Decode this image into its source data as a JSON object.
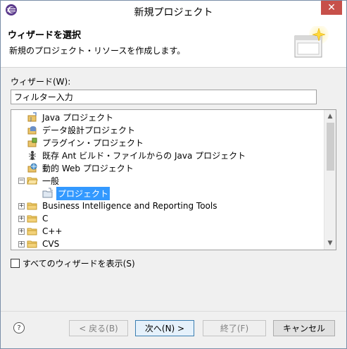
{
  "window": {
    "title": "新規プロジェクト",
    "close_label": "✕"
  },
  "header": {
    "title": "ウィザードを選択",
    "description": "新規のプロジェクト・リソースを作成します。"
  },
  "wizard_label": "ウィザード(W):",
  "filter": {
    "value": "フィルター入力"
  },
  "tree": {
    "items": [
      {
        "label": "Java プロジェクト",
        "icon": "java-project-icon"
      },
      {
        "label": "データ設計プロジェクト",
        "icon": "data-design-project-icon"
      },
      {
        "label": "プラグイン・プロジェクト",
        "icon": "plugin-project-icon"
      },
      {
        "label": "既存 Ant ビルド・ファイルからの Java プロジェクト",
        "icon": "ant-build-icon"
      },
      {
        "label": "動的 Web プロジェクト",
        "icon": "web-project-icon"
      },
      {
        "label": "一般",
        "icon": "folder-open-icon",
        "expander": "−"
      },
      {
        "label": "プロジェクト",
        "icon": "project-icon",
        "selected": true
      },
      {
        "label": "Business Intelligence and Reporting Tools",
        "icon": "folder-icon",
        "expander": "+"
      },
      {
        "label": "C",
        "icon": "folder-icon",
        "expander": "+"
      },
      {
        "label": "C++",
        "icon": "folder-icon",
        "expander": "+"
      },
      {
        "label": "CVS",
        "icon": "folder-icon",
        "expander": "+"
      }
    ]
  },
  "show_all_label": "すべてのウィザードを表示(S)",
  "buttons": {
    "help": "?",
    "back": "< 戻る(B)",
    "next": "次へ(N) >",
    "finish": "終了(F)",
    "cancel": "キャンセル"
  },
  "colors": {
    "selection": "#3399ff",
    "close": "#c7504a"
  }
}
